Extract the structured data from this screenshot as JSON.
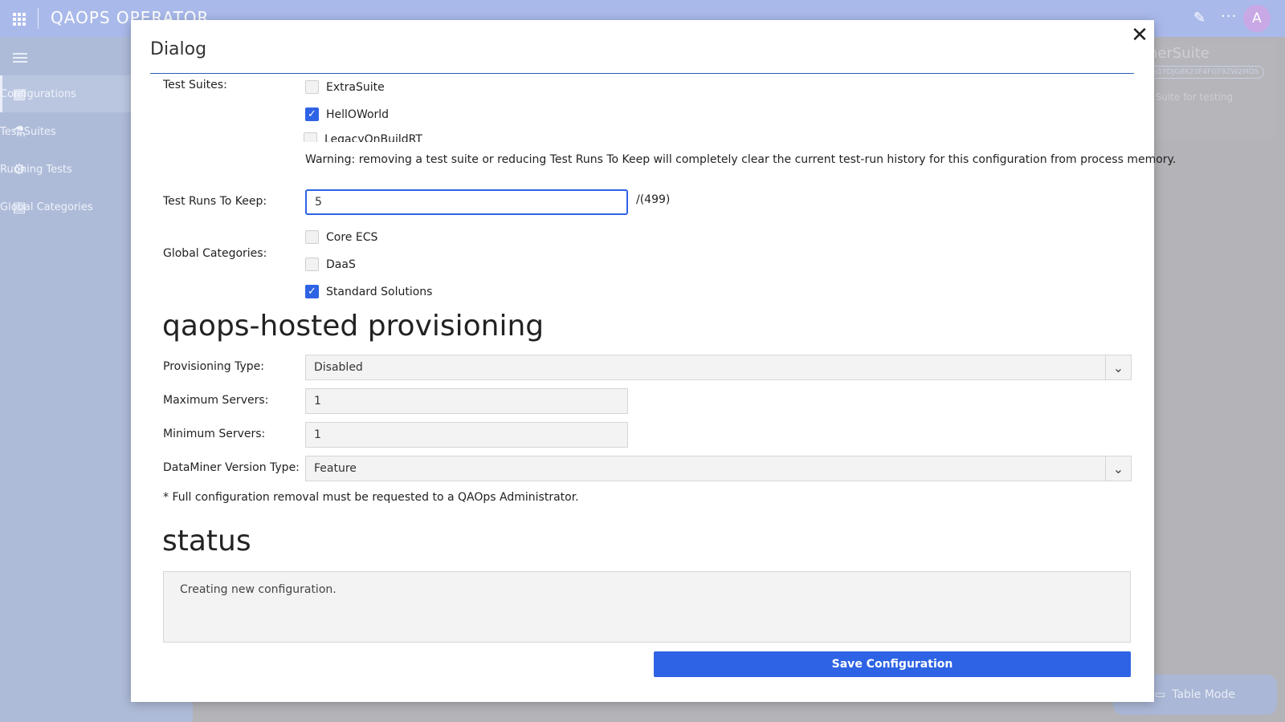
{
  "app": {
    "title": "QAOPS OPERATOR",
    "avatar_initial": "A"
  },
  "sidebar": {
    "items": [
      {
        "label": "Configurations",
        "icon": "configurations-icon"
      },
      {
        "label": "Test Suites",
        "icon": "flask-icon"
      },
      {
        "label": "Running Tests",
        "icon": "running-icon"
      },
      {
        "label": "Global Categories",
        "icon": "categories-icon"
      }
    ]
  },
  "background_panel": {
    "title_fragment": "nerSuite",
    "id_fragment": "6J1YDJG8K23F4FGT9ZW2MDS",
    "desc_fragment": "r Suite for testing"
  },
  "table_mode_label": "Table Mode",
  "dialog": {
    "title": "Dialog",
    "test_suites": {
      "label": "Test Suites:",
      "items": [
        {
          "name": "ExtraSuite",
          "checked": false
        },
        {
          "name": "HellOWorld",
          "checked": true
        },
        {
          "name": "LegacyOnBuildRT",
          "checked": false
        }
      ]
    },
    "warning": "Warning: removing a test suite or reducing Test Runs To Keep will completely clear the current test-run history for this configuration from process memory.",
    "test_runs": {
      "label": "Test Runs To Keep:",
      "value": "5",
      "max_suffix": "/(499)"
    },
    "global_categories": {
      "label": "Global Categories:",
      "items": [
        {
          "name": "Core ECS",
          "checked": false
        },
        {
          "name": "DaaS",
          "checked": false
        },
        {
          "name": "Standard Solutions",
          "checked": true
        }
      ]
    },
    "provisioning": {
      "heading": "qaops-hosted provisioning",
      "type_label": "Provisioning Type:",
      "type_value": "Disabled",
      "max_label": "Maximum Servers:",
      "max_value": "1",
      "min_label": "Minimum Servers:",
      "min_value": "1",
      "version_label": "DataMiner Version Type:",
      "version_value": "Feature"
    },
    "note": "* Full configuration removal must be requested to a QAOps Administrator.",
    "status": {
      "heading": "status",
      "text": "Creating new configuration."
    },
    "save_label": "Save Configuration"
  },
  "colors": {
    "accent": "#2e63e5",
    "topbar": "#a9b9ea"
  }
}
